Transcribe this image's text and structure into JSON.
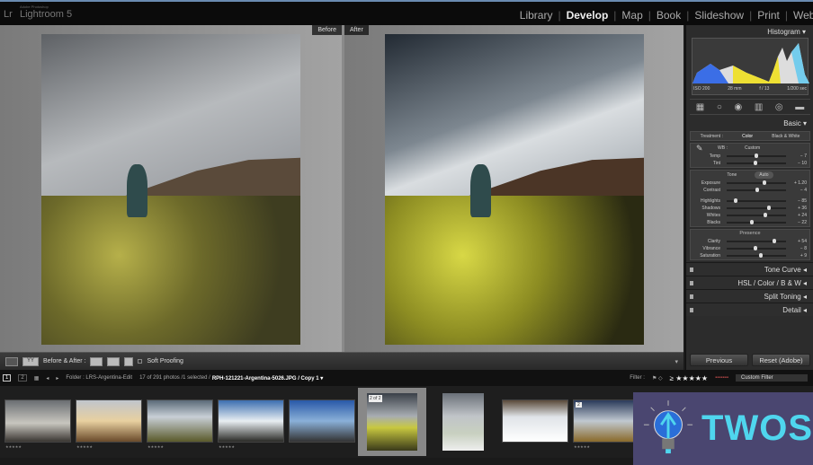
{
  "app": {
    "small_title": "Adobe Photoshop",
    "title": "Lightroom 5",
    "icon": "lr-logo-icon"
  },
  "modules": [
    {
      "label": "Library"
    },
    {
      "label": "Develop",
      "active": true
    },
    {
      "label": "Map"
    },
    {
      "label": "Book"
    },
    {
      "label": "Slideshow"
    },
    {
      "label": "Print"
    },
    {
      "label": "Web"
    }
  ],
  "view": {
    "before_label": "Before",
    "after_label": "After"
  },
  "toolbar": {
    "before_after_label": "Before & After :",
    "soft_proofing_label": "Soft Proofing",
    "yy_label": "YY"
  },
  "right_panel": {
    "histogram_title": "Histogram",
    "hist_info": [
      "ISO 200",
      "28 mm",
      "f / 13",
      "1/200 sec"
    ],
    "basic_title": "Basic",
    "treatment_label": "Treatment :",
    "color_label": "Color",
    "bw_label": "Black & White",
    "wb_label": "WB :",
    "wb_value": "Custom",
    "wb_sliders": [
      {
        "label": "Temp",
        "value": "− 7",
        "pos": 0.47
      },
      {
        "label": "Tint",
        "value": "− 10",
        "pos": 0.46
      }
    ],
    "tone_label": "Tone",
    "auto_label": "Auto",
    "tone_sliders": [
      {
        "label": "Exposure",
        "value": "+ 1.20",
        "pos": 0.6
      },
      {
        "label": "Contrast",
        "value": "− 4",
        "pos": 0.48
      }
    ],
    "tone_sliders2": [
      {
        "label": "Highlights",
        "value": "− 85",
        "pos": 0.12
      },
      {
        "label": "Shadows",
        "value": "+ 36",
        "pos": 0.68
      },
      {
        "label": "Whites",
        "value": "+ 24",
        "pos": 0.62
      },
      {
        "label": "Blacks",
        "value": "− 22",
        "pos": 0.39
      }
    ],
    "presence_label": "Presence",
    "presence_sliders": [
      {
        "label": "Clarity",
        "value": "+ 54",
        "pos": 0.77
      },
      {
        "label": "Vibrance",
        "value": "− 8",
        "pos": 0.46
      },
      {
        "label": "Saturation",
        "value": "+ 9",
        "pos": 0.54
      }
    ],
    "sections": [
      "Tone Curve",
      "HSL / Color / B & W",
      "Split Toning",
      "Detail"
    ],
    "previous_label": "Previous",
    "reset_label": "Reset (Adobe)"
  },
  "filmstrip": {
    "page1": "1",
    "page2": "2",
    "folder": "Folder : LRS-Argentina-Edit",
    "count": "17 of 291 photos /1 selected /",
    "filename": "RPH-121221-Argentina-5026.JPG / Copy 1 ▾",
    "filter_label": "Filter :",
    "rating": "≥ ★★★★★",
    "custom_filter": "Custom Filter",
    "selected_badge": "2 of 2",
    "badge2": "2"
  },
  "watermark": {
    "text": "TWOS"
  },
  "colors": {
    "accent_twos": "#4fd6ee",
    "watermark_bg": "#4a4670"
  }
}
